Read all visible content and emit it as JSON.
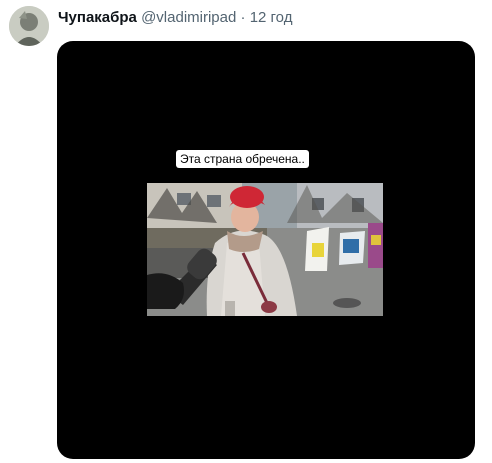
{
  "tweet": {
    "author_name": "Чупакабра",
    "author_handle": "@vladimiripad",
    "separator": "·",
    "time": "12 год"
  },
  "media": {
    "caption": "Эта страна обречена.."
  },
  "icons": {
    "avatar": "avatar-image"
  }
}
